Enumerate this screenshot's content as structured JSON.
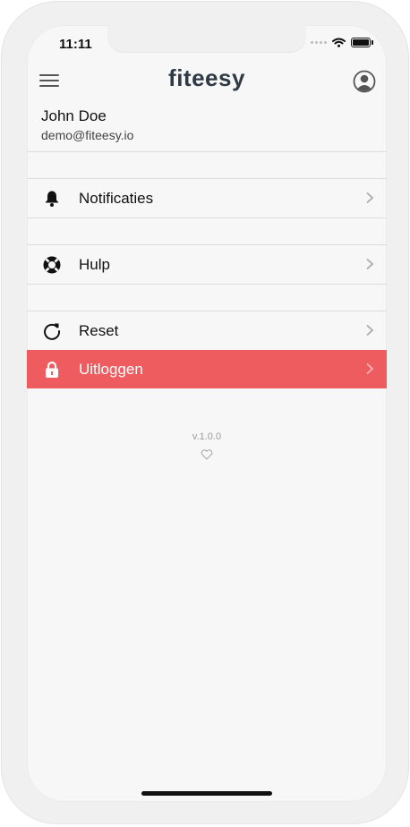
{
  "status_bar": {
    "time": "11:11"
  },
  "header": {
    "logo": "fiteesy"
  },
  "user": {
    "name": "John Doe",
    "email": "demo@fiteesy.io"
  },
  "menu": {
    "items": [
      {
        "label": "Notificaties",
        "icon": "bell-icon"
      },
      {
        "label": "Hulp",
        "icon": "lifebuoy-icon"
      },
      {
        "label": "Reset",
        "icon": "refresh-icon"
      },
      {
        "label": "Uitloggen",
        "icon": "lock-icon"
      }
    ]
  },
  "footer": {
    "version": "v.1.0.0",
    "icon": "heart-icon"
  },
  "colors": {
    "logout_bg": "#ef5c5f",
    "logo": "#2f3a44",
    "background": "#f7f7f7"
  }
}
